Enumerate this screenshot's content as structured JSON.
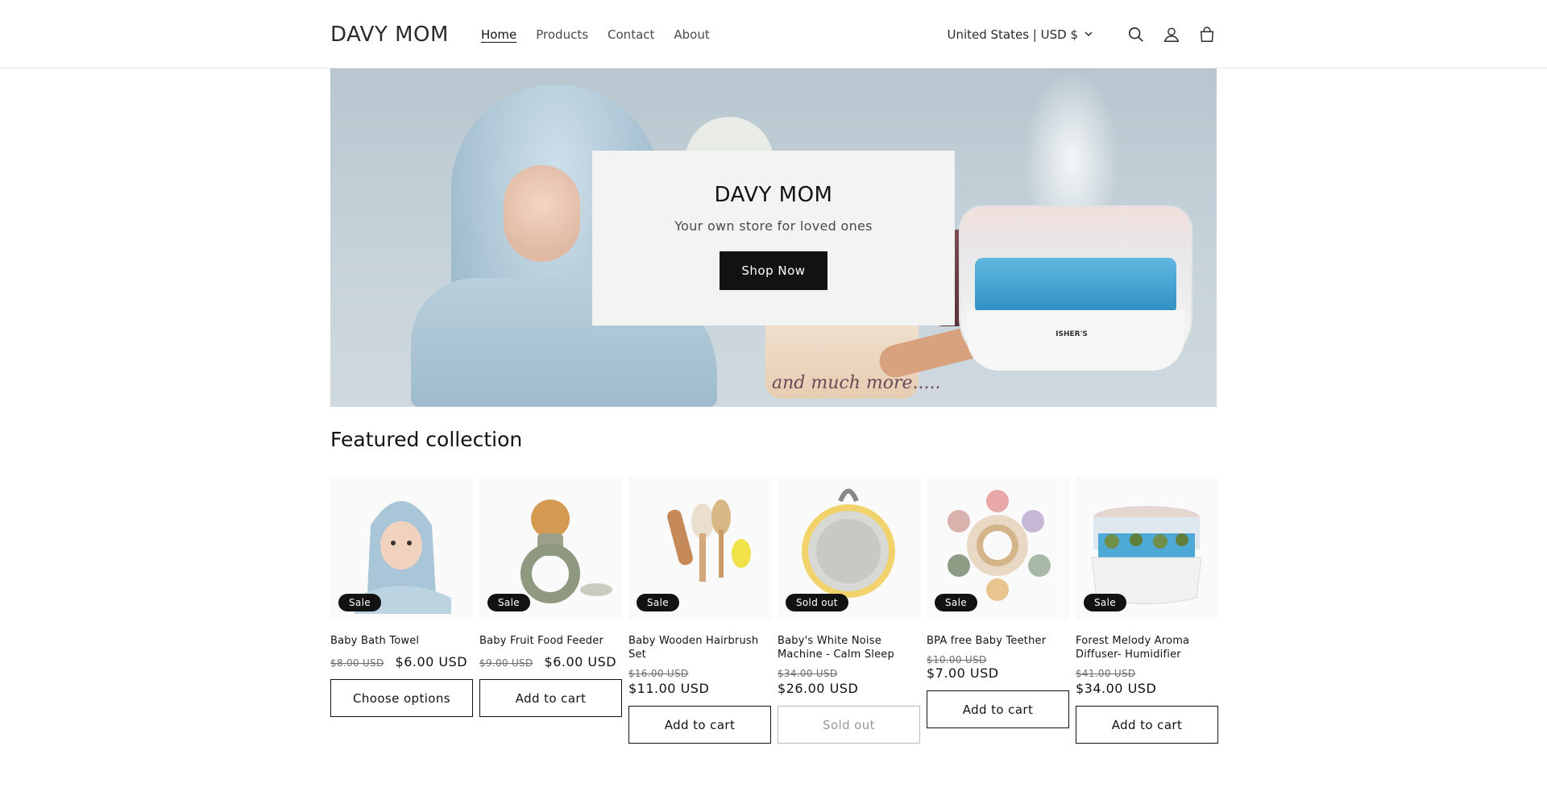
{
  "header": {
    "logo": "DAVY MOM",
    "nav": [
      {
        "label": "Home",
        "active": true
      },
      {
        "label": "Products",
        "active": false
      },
      {
        "label": "Contact",
        "active": false
      },
      {
        "label": "About",
        "active": false
      }
    ],
    "country_selector": "United States | USD $",
    "icons": [
      "search-icon",
      "account-icon",
      "cart-icon"
    ]
  },
  "hero": {
    "title": "DAVY MOM",
    "subtitle": "Your own store for loved ones",
    "button": "Shop Now",
    "image_script_text": "and much more.....",
    "image_brand_text": "ISHER'S"
  },
  "featured": {
    "title": "Featured collection",
    "products": [
      {
        "name": "Baby Bath Towel",
        "badge": "Sale",
        "old_price": "$8.00 USD",
        "price": "$6.00 USD",
        "button": "Choose options",
        "button_enabled": true
      },
      {
        "name": "Baby Fruit Food Feeder",
        "badge": "Sale",
        "old_price": "$9.00 USD",
        "price": "$6.00 USD",
        "button": "Add to cart",
        "button_enabled": true
      },
      {
        "name": "Baby Wooden Hairbrush Set",
        "badge": "Sale",
        "old_price": "$16.00 USD",
        "price": "$11.00 USD",
        "button": "Add to cart",
        "button_enabled": true
      },
      {
        "name": "Baby's White Noise Machine - Calm Sleep",
        "badge": "Sold out",
        "old_price": "$34.00 USD",
        "price": "$26.00 USD",
        "button": "Sold out",
        "button_enabled": false
      },
      {
        "name": "BPA free Baby Teether",
        "badge": "Sale",
        "old_price": "$10.00 USD",
        "price": "$7.00 USD",
        "button": "Add to cart",
        "button_enabled": true
      },
      {
        "name": "Forest Melody Aroma Diffuser- Humidifier",
        "badge": "Sale",
        "old_price": "$41.00 USD",
        "price": "$34.00 USD",
        "button": "Add to cart",
        "button_enabled": true
      }
    ]
  }
}
